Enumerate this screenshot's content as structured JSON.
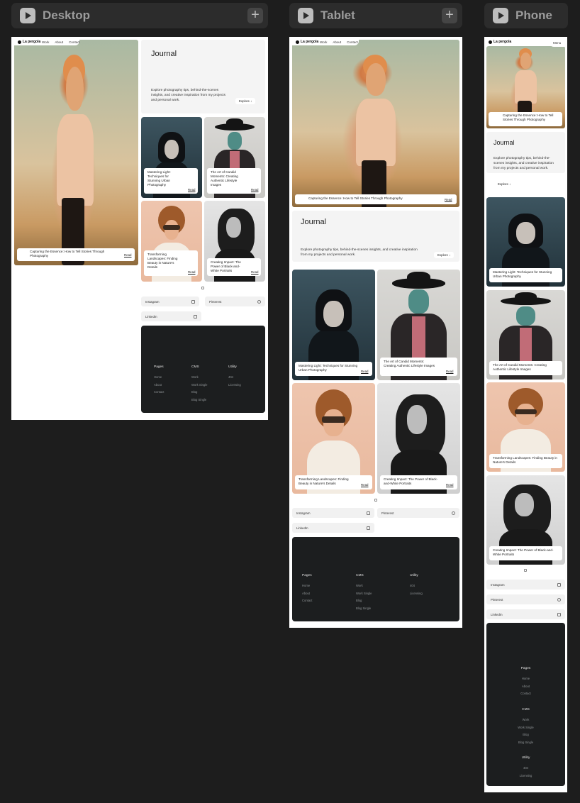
{
  "breakpoints": {
    "desktop": {
      "label": "Desktop"
    },
    "tablet": {
      "label": "Tablet"
    },
    "phone": {
      "label": "Phone"
    }
  },
  "site": {
    "logo": "La pergola",
    "nav": [
      "Work",
      "About",
      "Contact"
    ],
    "menu": "Menu",
    "hero_caption": "Capturing the Essence: How to Tell Stories Through Photography",
    "read": "Read",
    "journal": {
      "title": "Journal",
      "desc": "Explore photography tips, behind-the-scenes insights, and creative inspiration from my projects and personal work.",
      "explore": "Explore ↓"
    },
    "cards": [
      {
        "title": "Mastering Light: Techniques for Stunning Urban Photography"
      },
      {
        "title": "The Art of Candid Moments: Creating Authentic Lifestyle Images"
      },
      {
        "title": "Transforming Landscapes: Finding Beauty in Nature's Details"
      },
      {
        "title": "Creating Impact: The Power of Black-and-White Portraits"
      }
    ],
    "social": [
      "Instagram",
      "Pinterest",
      "LinkedIn"
    ],
    "footer": {
      "pages": {
        "heading": "Pages",
        "links": [
          "Home",
          "About",
          "Contact"
        ]
      },
      "cms": {
        "heading": "CMS",
        "links": [
          "Work",
          "Work Single",
          "Blog",
          "Blog Single"
        ]
      },
      "utility": {
        "heading": "Utility",
        "links": [
          "404",
          "Licensing"
        ]
      }
    }
  }
}
